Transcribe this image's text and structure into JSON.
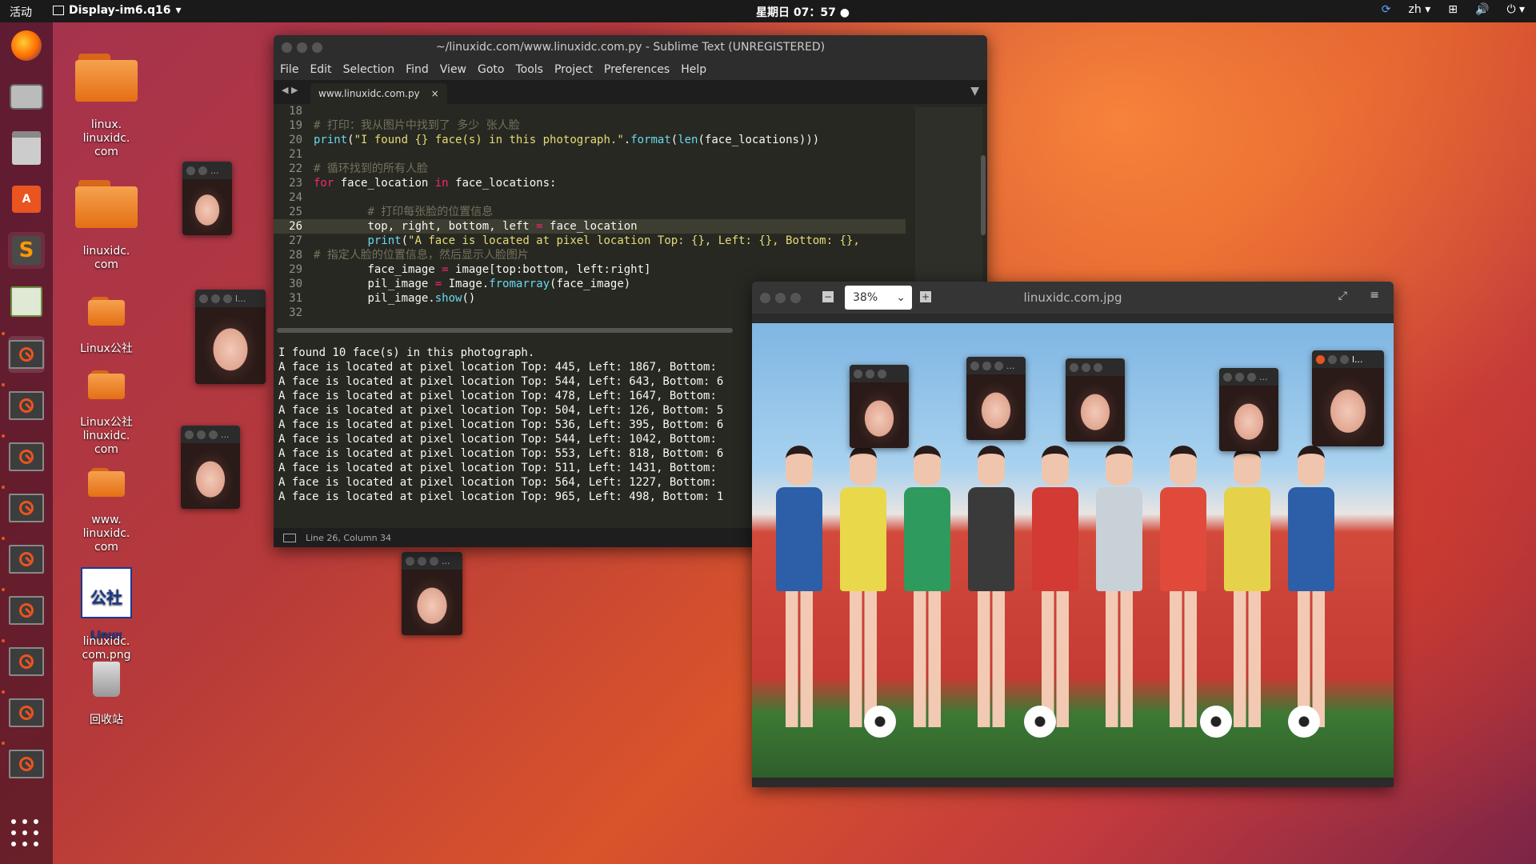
{
  "topbar": {
    "activities": "活动",
    "app": "Display-im6.q16",
    "clock": "星期日 07：57",
    "lang": "zh"
  },
  "desktop": {
    "icons": [
      {
        "label": "linux.\nlinuxidc.\ncom"
      },
      {
        "label": "linuxidc.\ncom"
      },
      {
        "label": "Linux公社"
      },
      {
        "label": "Linux公社\nlinuxidc.\ncom"
      },
      {
        "label": "www.\nlinuxidc.\ncom"
      },
      {
        "label": "linuxidc.\ncom.png"
      },
      {
        "label": "回收站"
      }
    ],
    "png_logo": {
      "top": "公社",
      "bottom": "Linux"
    }
  },
  "editor": {
    "title": "~/linuxidc.com/www.linuxidc.com.py - Sublime Text (UNREGISTERED)",
    "menu": [
      "File",
      "Edit",
      "Selection",
      "Find",
      "View",
      "Goto",
      "Tools",
      "Project",
      "Preferences",
      "Help"
    ],
    "tab": "www.linuxidc.com.py",
    "lines": {
      "n18": "18",
      "n19": "19",
      "n20": "20",
      "n21": "21",
      "n22": "22",
      "n23": "23",
      "n24": "24",
      "n25": "25",
      "n26": "26",
      "n27": "27",
      "n28": "28",
      "n29": "29",
      "n30": "30",
      "n31": "31",
      "n32": "32",
      "l19": "# 打印：我从图片中找到了 多少 张人脸",
      "l20a": "print",
      "l20b": "(",
      "l20c": "\"I found {} face(s) in this photograph.\"",
      "l20d": ".",
      "l20e": "format",
      "l20f": "(",
      "l20g": "len",
      "l20h": "(face_locations)))",
      "l22": "# 循环找到的所有人脸",
      "l23a": "for",
      "l23b": " face_location ",
      "l23c": "in",
      "l23d": " face_locations:",
      "l25": "# 打印每张脸的位置信息",
      "l26a": "top, right, bottom, left ",
      "l26b": "=",
      "l26c": " face_location",
      "l27a": "print",
      "l27b": "(",
      "l27c": "\"A face is located at pixel location Top: {}, Left: {}, Bottom: {},",
      "l28": "# 指定人脸的位置信息，然后显示人脸图片",
      "l29a": "face_image ",
      "l29b": "=",
      "l29c": " image[top:bottom, left:right]",
      "l30a": "pil_image ",
      "l30b": "=",
      "l30c": " Image.",
      "l30d": "fromarray",
      "l30e": "(face_image)",
      "l31a": "pil_image.",
      "l31b": "show",
      "l31c": "()"
    },
    "output": [
      "I found 10 face(s) in this photograph.",
      "A face is located at pixel location Top: 445, Left: 1867, Bottom:",
      "A face is located at pixel location Top: 544, Left: 643, Bottom: 6",
      "A face is located at pixel location Top: 478, Left: 1647, Bottom:",
      "A face is located at pixel location Top: 504, Left: 126, Bottom: 5",
      "A face is located at pixel location Top: 536, Left: 395, Bottom: 6",
      "A face is located at pixel location Top: 544, Left: 1042, Bottom:",
      "A face is located at pixel location Top: 553, Left: 818, Bottom: 6",
      "A face is located at pixel location Top: 511, Left: 1431, Bottom:",
      "A face is located at pixel location Top: 564, Left: 1227, Bottom:",
      "A face is located at pixel location Top: 965, Left: 498, Bottom: 1"
    ],
    "status": "Line 26, Column 34"
  },
  "viewer": {
    "title": "linuxidc.com.jpg",
    "zoom": "38%"
  },
  "face_windows": {
    "title_l": "l...",
    "title_dots": "..."
  },
  "colors": {
    "accent": "#e95420",
    "editor_bg": "#272822",
    "comment": "#75715e",
    "keyword": "#f92672",
    "string": "#e6db74"
  }
}
